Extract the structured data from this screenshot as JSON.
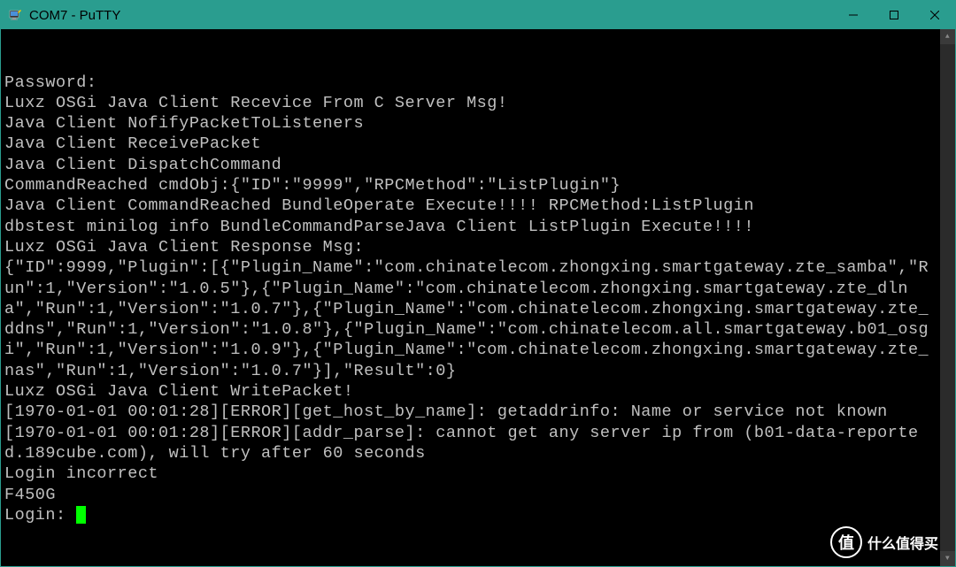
{
  "window": {
    "title": "COM7 - PuTTY",
    "minimize": "—",
    "maximize": "☐",
    "close": "✕"
  },
  "terminal": {
    "lines": [
      "Password:",
      "Luxz OSGi Java Client Recevice From C Server Msg!",
      "Java Client NofifyPacketToListeners",
      "Java Client ReceivePacket",
      "Java Client DispatchCommand",
      "CommandReached cmdObj:{\"ID\":\"9999\",\"RPCMethod\":\"ListPlugin\"}",
      "Java Client CommandReached BundleOperate Execute!!!! RPCMethod:ListPlugin",
      "dbstest minilog info BundleCommandParseJava Client ListPlugin Execute!!!!",
      "Luxz OSGi Java Client Response Msg:",
      "{\"ID\":9999,\"Plugin\":[{\"Plugin_Name\":\"com.chinatelecom.zhongxing.smartgateway.zte_samba\",\"Run\":1,\"Version\":\"1.0.5\"},{\"Plugin_Name\":\"com.chinatelecom.zhongxing.smartgateway.zte_dlna\",\"Run\":1,\"Version\":\"1.0.7\"},{\"Plugin_Name\":\"com.chinatelecom.zhongxing.smartgateway.zte_ddns\",\"Run\":1,\"Version\":\"1.0.8\"},{\"Plugin_Name\":\"com.chinatelecom.all.smartgateway.b01_osgi\",\"Run\":1,\"Version\":\"1.0.9\"},{\"Plugin_Name\":\"com.chinatelecom.zhongxing.smartgateway.zte_nas\",\"Run\":1,\"Version\":\"1.0.7\"}],\"Result\":0}",
      "Luxz OSGi Java Client WritePacket!",
      "[1970-01-01 00:01:28][ERROR][get_host_by_name]: getaddrinfo: Name or service not known",
      "[1970-01-01 00:01:28][ERROR][addr_parse]: cannot get any server ip from (b01-data-reported.189cube.com), will try after 60 seconds",
      "Login incorrect",
      "F450G"
    ],
    "prompt": "Login: "
  },
  "scrollbar": {
    "up": "▲",
    "down": "▼"
  },
  "watermark": {
    "badge": "值",
    "text": "什么值得买"
  }
}
